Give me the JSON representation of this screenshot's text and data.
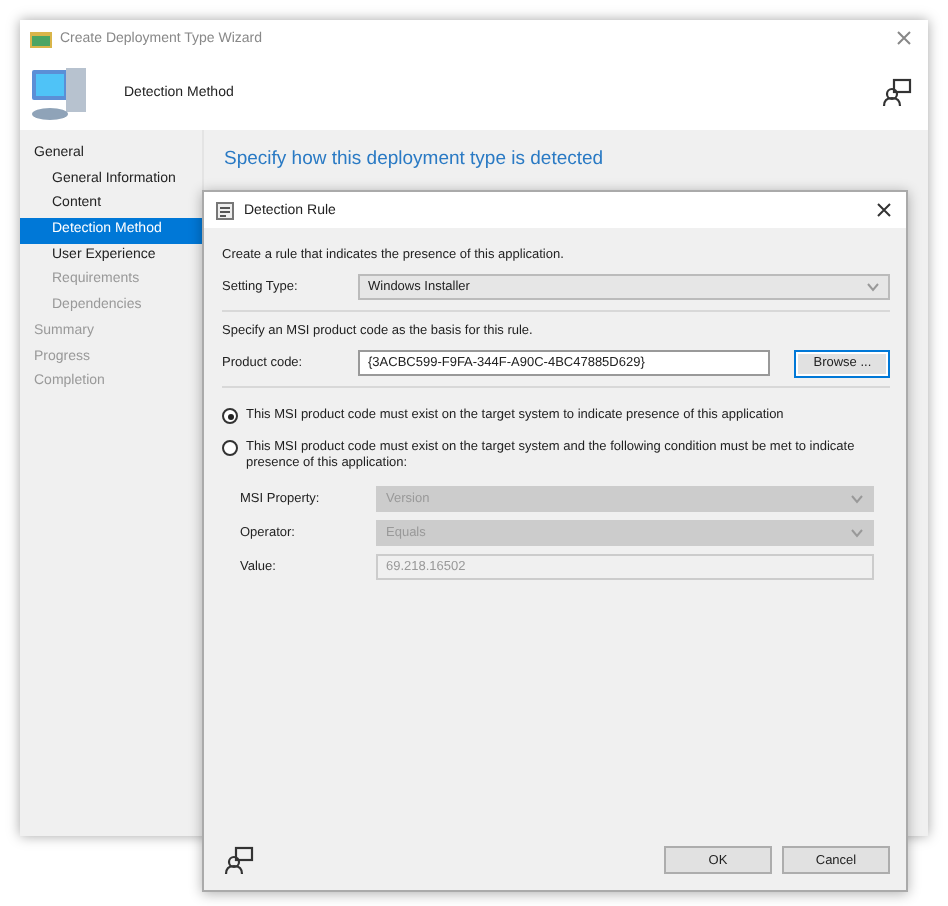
{
  "wizard": {
    "title": "Create Deployment Type Wizard",
    "header": "Detection Method",
    "heading": "Specify how this deployment type is detected",
    "nav": [
      {
        "label": "General",
        "selected": false,
        "disabled": false,
        "children": [
          {
            "label": "General Information",
            "selected": false,
            "disabled": false
          },
          {
            "label": "Content",
            "selected": false,
            "disabled": false
          },
          {
            "label": "Detection Method",
            "selected": true,
            "disabled": false
          },
          {
            "label": "User Experience",
            "selected": false,
            "disabled": false
          },
          {
            "label": "Requirements",
            "selected": false,
            "disabled": true
          },
          {
            "label": "Dependencies",
            "selected": false,
            "disabled": true
          }
        ]
      },
      {
        "label": "Summary",
        "selected": false,
        "disabled": true
      },
      {
        "label": "Progress",
        "selected": false,
        "disabled": true
      },
      {
        "label": "Completion",
        "selected": false,
        "disabled": true
      }
    ]
  },
  "dialog": {
    "title": "Detection Rule",
    "intro": "Create a rule that indicates the presence of this application.",
    "setting_type": {
      "label": "Setting Type:",
      "value": "Windows Installer"
    },
    "basis_note": "Specify an MSI product code as the basis for this rule.",
    "product_code": {
      "label": "Product code:",
      "value": "{3ACBC599-F9FA-344F-A90C-4BC47885D629}",
      "button": "Browse ..."
    },
    "options": [
      {
        "label": "This MSI product code must exist on the target system to indicate presence of this application",
        "selected": true
      },
      {
        "label": "This MSI product code must exist on the target system and the following condition must be met to indicate presence of this application:",
        "selected": false
      }
    ],
    "condition": {
      "disabled": true,
      "fields": [
        {
          "kind": "select",
          "label": "MSI Property:",
          "value": "Version"
        },
        {
          "kind": "select",
          "label": "Operator:",
          "value": "Equals"
        },
        {
          "kind": "input",
          "label": "Value:",
          "value": "69.218.16502"
        }
      ]
    },
    "buttons": [
      "OK",
      "Cancel"
    ]
  }
}
